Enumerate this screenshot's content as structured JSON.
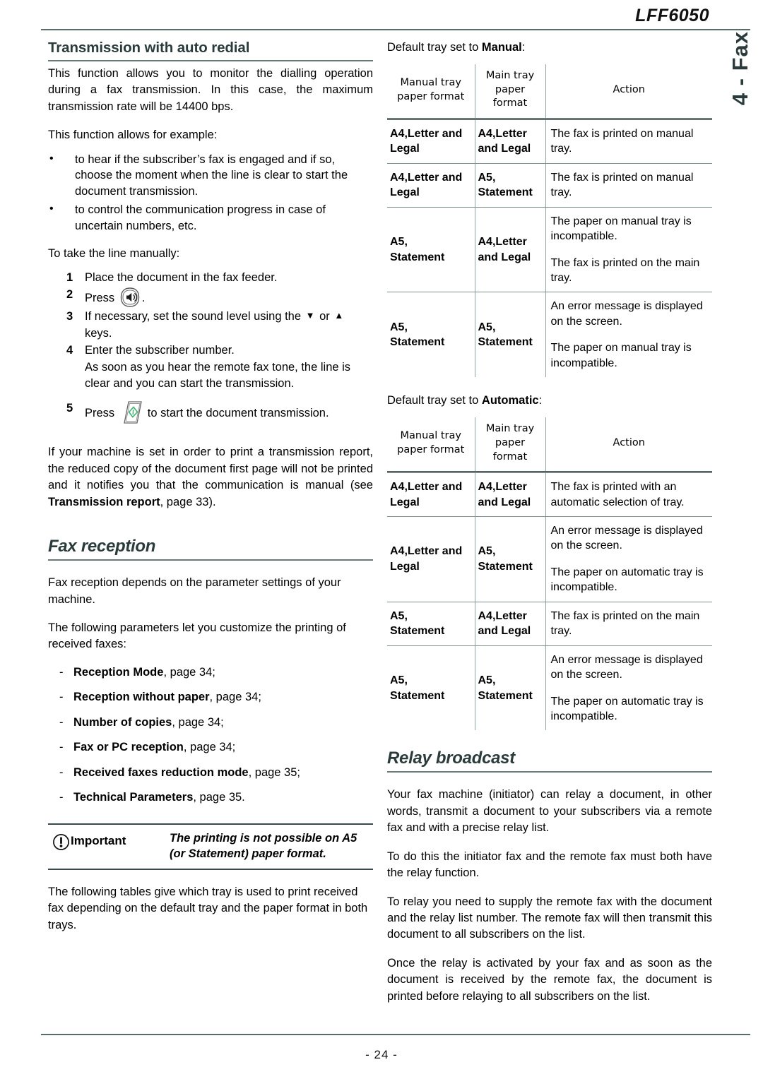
{
  "header": {
    "title": "LFF6050",
    "side_tab": "4 - Fax"
  },
  "footer": {
    "page_number": "- 24 -"
  },
  "left_column": {
    "heading": "Transmission with auto redial",
    "intro_para": "This function allows you to monitor the dialling operation during a fax transmission. In this case, the maximum transmission rate will be 14400 bps.",
    "example_lead": "This function allows for example:",
    "example_bullets": [
      "to hear if the subscriber’s fax is engaged and if so, choose the moment when the line is clear to start the document transmission.",
      "to control the communication progress in case of uncertain numbers, etc."
    ],
    "steps_lead": "To take the line manually:",
    "steps": [
      {
        "num": "1",
        "text": "Place the document in the fax feeder."
      },
      {
        "num": "2",
        "text_before": "Press",
        "icon": "speaker-key-icon",
        "text_after": "."
      },
      {
        "num": "3",
        "text_before": "If necessary, set the sound level using the",
        "icon_down": "arrow-down-icon",
        "mid": "or",
        "icon_up": "arrow-up-icon",
        "text_after": "keys."
      },
      {
        "num": "4",
        "text": "Enter the subscriber number.",
        "text2": "As soon as you hear the remote fax tone, the line is clear and you can start the transmission."
      },
      {
        "num": "5",
        "text_before": "Press",
        "icon": "start-key-icon",
        "text_after": "to start the document transmission."
      }
    ],
    "report_para_1": "If your machine is set in order to print a transmission report, the reduced copy of the document first page will not be printed and it notifies you that the communication is manual (see ",
    "report_para_bold": "Transmission report",
    "report_para_2": ", page 33).",
    "fax_reception_heading": "Fax reception",
    "fax_reception_para": "Fax reception depends on the parameter settings of your machine.",
    "params_lead": "The following parameters let you customize the printing of received faxes:",
    "params": [
      {
        "label": "Reception Mode",
        "ref": ", page 34;"
      },
      {
        "label": "Reception without paper",
        "ref": ", page 34;"
      },
      {
        "label": "Number of copies",
        "ref": ", page 34;"
      },
      {
        "label": "Fax or PC reception",
        "ref": ", page 34;"
      },
      {
        "label": "Received faxes reduction mode",
        "ref": ", page 35;"
      },
      {
        "label": "Technical Parameters",
        "ref": ", page 35."
      }
    ],
    "note": {
      "icon": "important-icon",
      "label": "Important",
      "text": "The printing is not possible on A5 (or Statement) paper format."
    },
    "tables_intro": "The following tables give which tray is used to print received fax depending on the default tray and the paper format in both trays."
  },
  "right_column": {
    "table_manual": {
      "intro_before": "Default tray set to ",
      "intro_bold": "Manual",
      "intro_after": ":",
      "headers": [
        "Manual tray\npaper format",
        "Main tray\npaper format",
        "Action"
      ],
      "header_lines": [
        [
          "Manual tray",
          "paper format"
        ],
        [
          "Main tray",
          "paper format"
        ],
        [
          "Action"
        ]
      ],
      "rows": [
        {
          "manual": [
            "A4,Letter and",
            "Legal"
          ],
          "main": [
            "A4,Letter",
            "and Legal"
          ],
          "action": [
            "The fax is printed on manual tray."
          ]
        },
        {
          "manual": [
            "A4,Letter and",
            "Legal"
          ],
          "main": [
            "A5,",
            "Statement"
          ],
          "action": [
            "The fax is printed on manual tray."
          ]
        },
        {
          "manual": [
            "A5,",
            "Statement"
          ],
          "main": [
            "A4,Letter",
            "and Legal"
          ],
          "action": [
            "The paper on manual tray is incompatible.",
            "The fax is printed on the main tray."
          ]
        },
        {
          "manual": [
            "A5,",
            "Statement"
          ],
          "main": [
            "A5,",
            "Statement"
          ],
          "action": [
            "An error message is displayed on the screen.",
            "The paper on manual tray is incompatible."
          ]
        }
      ]
    },
    "table_automatic": {
      "intro_before": "Default tray set to ",
      "intro_bold": "Automatic",
      "intro_after": ":",
      "header_lines": [
        [
          "Manual tray",
          "paper format"
        ],
        [
          "Main tray",
          "paper format"
        ],
        [
          "Action"
        ]
      ],
      "rows": [
        {
          "manual": [
            "A4,Letter and",
            "Legal"
          ],
          "main": [
            "A4,Letter",
            "and Legal"
          ],
          "action": [
            "The fax is printed with an automatic selection of tray."
          ]
        },
        {
          "manual": [
            "A4,Letter and",
            "Legal"
          ],
          "main": [
            "A5,",
            "Statement"
          ],
          "action": [
            "An error message is displayed on the screen.",
            "The paper on automatic tray is incompatible."
          ]
        },
        {
          "manual": [
            "A5,",
            "Statement"
          ],
          "main": [
            "A4,Letter",
            "and Legal"
          ],
          "action": [
            "The fax is printed on the main tray."
          ]
        },
        {
          "manual": [
            "A5,",
            "Statement"
          ],
          "main": [
            "A5,",
            "Statement"
          ],
          "action": [
            "An error message is displayed on the screen.",
            "The paper on automatic tray is incompatible."
          ]
        }
      ]
    },
    "relay_heading": "Relay broadcast",
    "relay_paras": [
      "Your fax machine (initiator) can relay a document, in other words, transmit a document to your subscribers via a remote fax and with a precise relay list.",
      "To do this the initiator fax and the remote fax must both have the relay function.",
      "To relay you need to supply the remote fax with the document and the relay list number. The remote fax will then transmit this document to all subscribers on the list.",
      "Once the relay is activated by your fax and as soon as the document is received by the remote fax, the document is printed before relaying to all subscribers on the list."
    ]
  },
  "colors": {
    "heading": "#2b3b3b",
    "rule": "#6a7a7a",
    "table_grid": "#8fa3a3",
    "start_key_green": "#3cb371"
  }
}
